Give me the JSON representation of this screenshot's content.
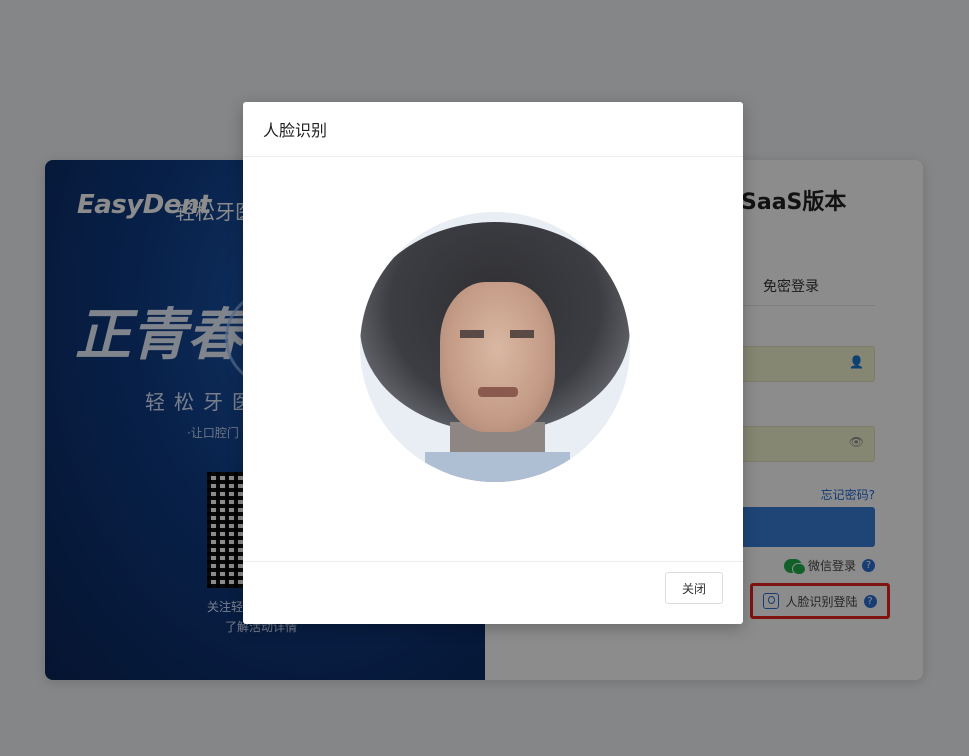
{
  "promo": {
    "logo": "EasyDent",
    "logo_cn": "轻松牙医",
    "slogan": "正青春",
    "subtitle": "轻松牙医",
    "subtitle2": "·让口腔门",
    "qr_caption1": "关注轻",
    "qr_caption2": "了解活动详情"
  },
  "login": {
    "title": "SaaS版本",
    "tab_password_free": "免密登录",
    "forgot_password": "忘记密码?",
    "wechat_login": "微信登录",
    "face_login": "人脸识别登陆",
    "help_glyph": "?"
  },
  "modal": {
    "title": "人脸识别",
    "close_label": "关闭"
  },
  "colors": {
    "accent": "#3a7fd8",
    "highlight_border": "#e8241c",
    "wechat": "#21b04b"
  }
}
